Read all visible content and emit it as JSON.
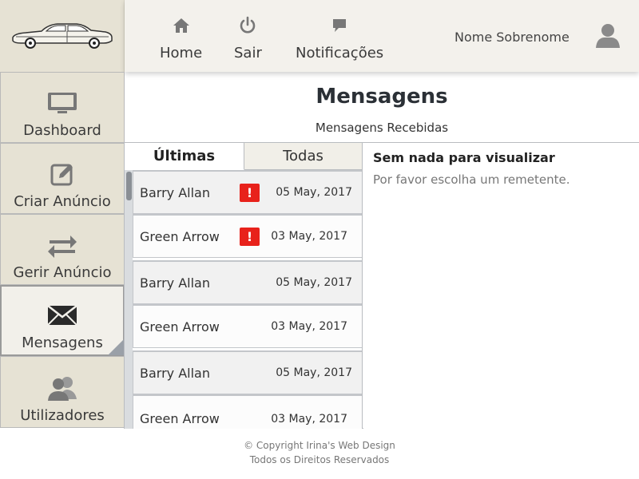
{
  "header": {
    "nav": [
      {
        "label": "Home",
        "icon": "home-icon"
      },
      {
        "label": "Sair",
        "icon": "power-icon"
      },
      {
        "label": "Notificações",
        "icon": "chat-icon"
      }
    ],
    "user_name": "Nome Sobrenome",
    "avatar_icon": "user-icon",
    "logo_icon": "car-icon"
  },
  "sidebar": {
    "items": [
      {
        "label": "Dashboard",
        "icon": "monitor-icon"
      },
      {
        "label": "Criar Anúncio",
        "icon": "edit-icon"
      },
      {
        "label": "Gerir Anúncio",
        "icon": "swap-icon"
      },
      {
        "label": "Mensagens",
        "icon": "envelope-icon",
        "active": true
      },
      {
        "label": "Utilizadores",
        "icon": "users-icon"
      }
    ]
  },
  "main": {
    "title": "Mensagens",
    "subtitle": "Mensagens Recebidas",
    "tabs": [
      {
        "label": "Últimas",
        "active": true
      },
      {
        "label": "Todas",
        "active": false
      }
    ],
    "messages": [
      {
        "sender": "Barry Allan",
        "date": "05 May, 2017",
        "alert": "!"
      },
      {
        "sender": "Green Arrow",
        "date": "03 May, 2017",
        "alert": "!"
      },
      {
        "sender": "Barry Allan",
        "date": "05 May, 2017",
        "alert": ""
      },
      {
        "sender": "Green Arrow",
        "date": "03 May, 2017",
        "alert": ""
      },
      {
        "sender": "Barry Allan",
        "date": "05 May, 2017",
        "alert": ""
      },
      {
        "sender": "Green Arrow",
        "date": "03 May, 2017",
        "alert": ""
      }
    ],
    "detail": {
      "title": "Sem nada para visualizar",
      "text": "Por favor escolha um remetente."
    }
  },
  "footer": {
    "line1": "© Copyright Irina's Web Design",
    "line2": "Todos os Direitos Reservados"
  },
  "colors": {
    "sidebar_bg": "#e6e2d4",
    "topbar_bg": "#f3f1ec",
    "alert_red": "#e8221b",
    "row_alt": "#f1f1f1"
  }
}
